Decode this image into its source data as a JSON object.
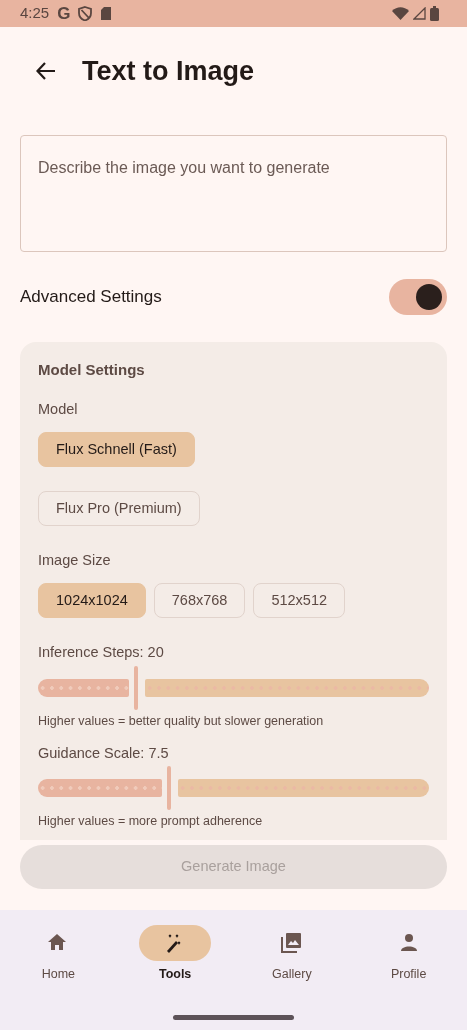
{
  "status_bar": {
    "time": "4:25",
    "carrier": "G"
  },
  "header": {
    "title": "Text to Image"
  },
  "prompt": {
    "placeholder": "Describe the image you want to generate"
  },
  "advanced_settings": {
    "label": "Advanced Settings",
    "on": true
  },
  "model_settings": {
    "title": "Model Settings",
    "model_label": "Model",
    "models": [
      {
        "label": "Flux Schnell (Fast)",
        "selected": true
      },
      {
        "label": "Flux Pro (Premium)",
        "selected": false
      }
    ],
    "size_label": "Image Size",
    "sizes": [
      {
        "label": "1024x1024",
        "selected": true
      },
      {
        "label": "768x768",
        "selected": false
      },
      {
        "label": "512x512",
        "selected": false
      }
    ],
    "sliders": [
      {
        "label": "Inference Steps: 20",
        "level": 0.25,
        "hint": "Higher values = better quality but slower generation"
      },
      {
        "label": "Guidance Scale: 7.5",
        "level": 0.335,
        "hint": "Higher values = more prompt adherence"
      }
    ]
  },
  "generate_button": {
    "label": "Generate Image",
    "disabled": true
  },
  "nav": [
    {
      "kind": "home",
      "label": "Home",
      "selected": false
    },
    {
      "kind": "tools",
      "label": "Tools",
      "selected": true
    },
    {
      "kind": "gallery",
      "label": "Gallery",
      "selected": false
    },
    {
      "kind": "profile",
      "label": "Profile",
      "selected": false
    }
  ]
}
